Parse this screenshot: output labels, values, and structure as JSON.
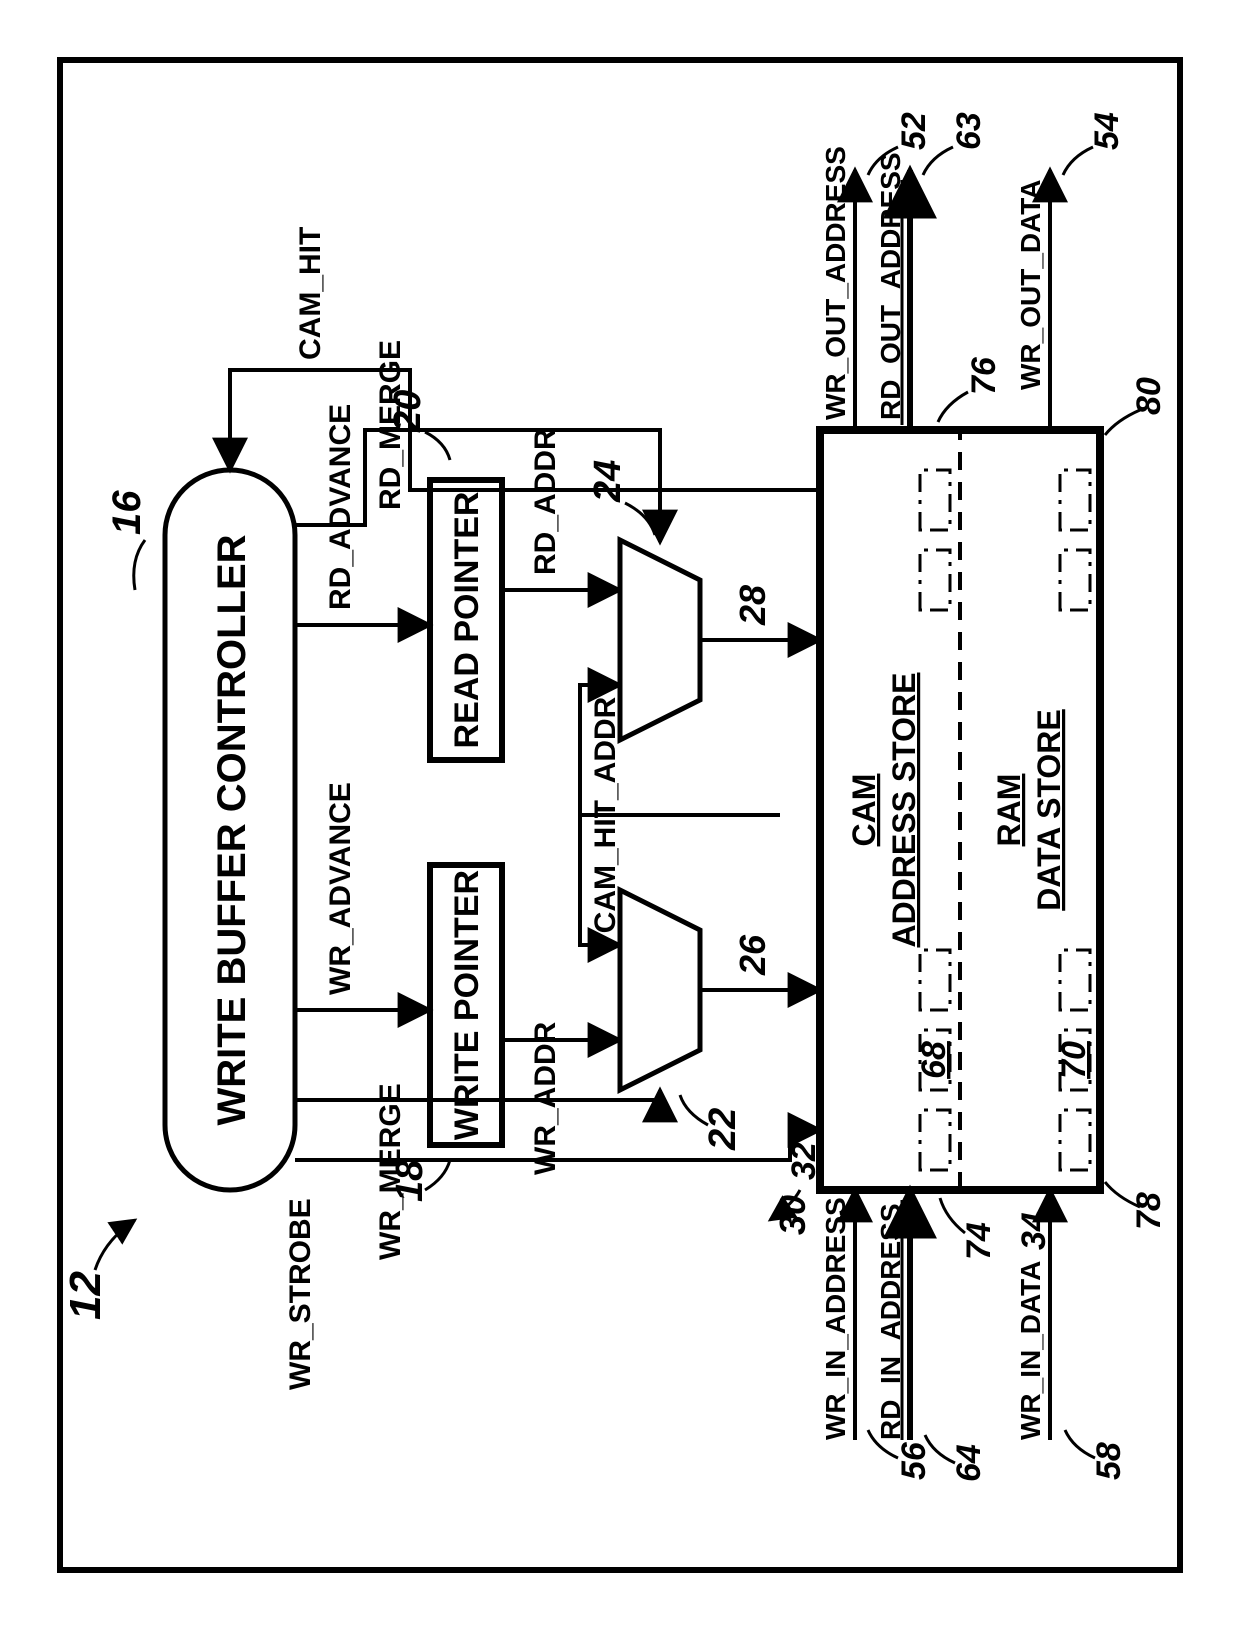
{
  "refs": {
    "main": "12",
    "controller": "16",
    "write_pointer": "18",
    "read_pointer": "20",
    "mux_write": "22",
    "mux_read": "24",
    "mux_write_out": "26",
    "mux_read_out": "28",
    "path_strobe": "30",
    "wr_in_address_to_cam": "32",
    "wr_in_data_to_ram": "34",
    "wr_out_address": "52",
    "wr_out_data": "54",
    "wr_in_address": "56",
    "wr_in_data": "58",
    "rd_out_address": "63",
    "rd_in_address": "64",
    "cam_row": "68",
    "ram_row": "70",
    "cam_block": "74",
    "rd_out_port": "76",
    "ram_block": "78",
    "wr_out_port": "80"
  },
  "signals": {
    "wr_strobe": "WR_STROBE",
    "wr_advance": "WR_ADVANCE",
    "rd_advance": "RD_ADVANCE",
    "wr_merge": "WR_MERGE",
    "rd_merge": "RD_MERGE",
    "wr_addr": "WR_ADDR",
    "rd_addr": "RD_ADDR",
    "cam_hit": "CAM_HIT",
    "cam_hit_addr": "CAM_HIT_ADDR",
    "wr_in_address": "WR_IN_ADDRESS",
    "rd_in_address": "RD_IN_ADDRESS",
    "wr_in_data": "WR_IN_DATA",
    "wr_out_address": "WR_OUT_ADDRESS",
    "rd_out_address": "RD_OUT_ADDRESS",
    "wr_out_data": "WR_OUT_DATA"
  },
  "blocks": {
    "controller": "WRITE BUFFER CONTROLLER",
    "write_pointer": "WRITE POINTER",
    "read_pointer": "READ POINTER",
    "cam_line1": "CAM",
    "cam_line2": "ADDRESS STORE",
    "ram_line1": "RAM",
    "ram_line2": "DATA STORE"
  }
}
